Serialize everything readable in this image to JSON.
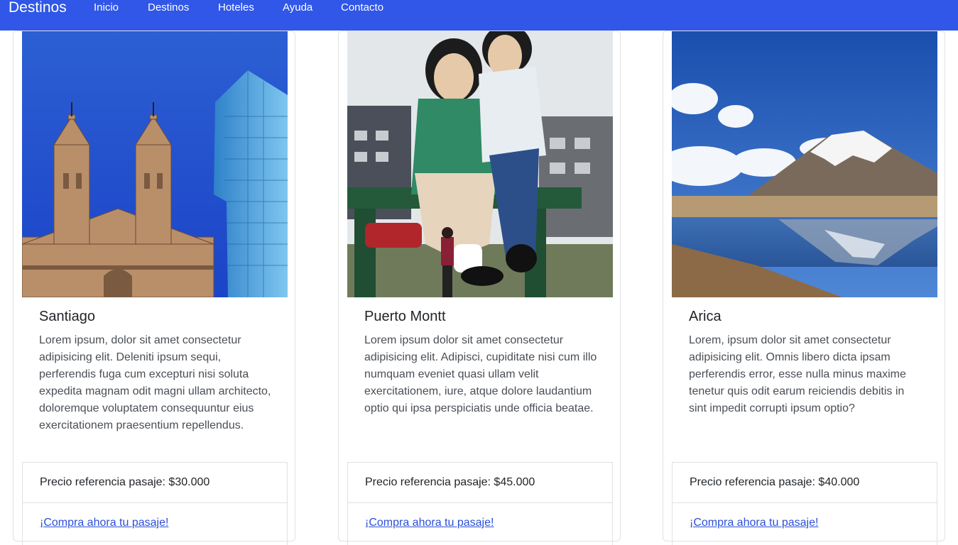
{
  "navbar": {
    "brand": "Destinos",
    "links": [
      "Inicio",
      "Destinos",
      "Hoteles",
      "Ayuda",
      "Contacto"
    ]
  },
  "cards": [
    {
      "title": "Santiago",
      "text": "Lorem ipsum, dolor sit amet consectetur adipisicing elit. Deleniti ipsum sequi, perferendis fuga cum excepturi nisi soluta expedita magnam odit magni ullam architecto, doloremque voluptatem consequuntur eius exercitationem praesentium repellendus.",
      "price": "Precio referencia pasaje: $30.000",
      "link": "¡Compra ahora tu pasaje!"
    },
    {
      "title": "Puerto Montt",
      "text": "Lorem ipsum dolor sit amet consectetur adipisicing elit. Adipisci, cupiditate nisi cum illo numquam eveniet quasi ullam velit exercitationem, iure, atque dolore laudantium optio qui ipsa perspiciatis unde officia beatae.",
      "price": "Precio referencia pasaje: $45.000",
      "link": "¡Compra ahora tu pasaje!"
    },
    {
      "title": "Arica",
      "text": "Lorem, ipsum dolor sit amet consectetur adipisicing elit. Omnis libero dicta ipsam perferendis error, esse nulla minus maxime tenetur quis odit earum reiciendis debitis in sint impedit corrupti ipsum optio?",
      "price": "Precio referencia pasaje: $40.000",
      "link": "¡Compra ahora tu pasaje!"
    }
  ],
  "colors": {
    "navbar": "#3057e8",
    "link": "#2b50d8"
  }
}
